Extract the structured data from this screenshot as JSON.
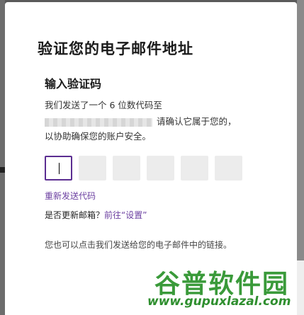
{
  "dialog": {
    "title": "验证您的电子邮件地址",
    "subtitle": "输入验证码",
    "desc_line1": "我们发送了一个 6 位数代码至",
    "desc_line2_suffix": "请确认它属于您的，",
    "desc_line3": "以协助确保您的账户安全。",
    "resend_label": "重新发送代码",
    "update_prefix": "是否更新邮箱？",
    "update_link": "前往“设置”",
    "alt_text": "您也可以点击我们发送给您的电子邮件中的链接。"
  },
  "code_boxes": [
    "",
    "",
    "",
    "",
    "",
    ""
  ],
  "watermark": {
    "logo": "谷普软件园",
    "url": "www.gupuxlazal.com"
  }
}
